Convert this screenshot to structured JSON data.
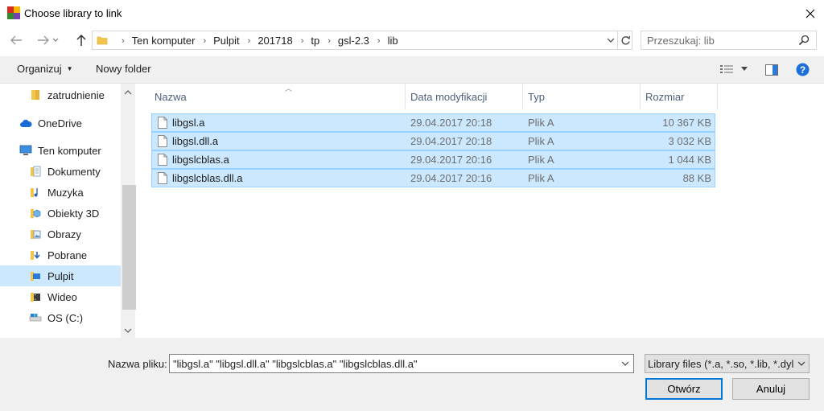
{
  "window": {
    "title": "Choose library to link"
  },
  "address": {
    "crumbs": [
      "Ten komputer",
      "Pulpit",
      "201718",
      "tp",
      "gsl-2.3",
      "lib"
    ]
  },
  "search": {
    "placeholder": "Przeszukaj: lib"
  },
  "toolbar": {
    "organize_label": "Organizuj",
    "new_folder_label": "Nowy folder"
  },
  "sidebar": {
    "items": [
      {
        "label": "zatrudnienie",
        "icon": "folder-icon"
      },
      {
        "label": "OneDrive",
        "icon": "cloud-icon"
      },
      {
        "label": "Ten komputer",
        "icon": "computer-icon"
      },
      {
        "label": "Dokumenty",
        "icon": "documents-icon"
      },
      {
        "label": "Muzyka",
        "icon": "music-icon"
      },
      {
        "label": "Obiekty 3D",
        "icon": "3d-objects-icon"
      },
      {
        "label": "Obrazy",
        "icon": "pictures-icon"
      },
      {
        "label": "Pobrane",
        "icon": "downloads-icon"
      },
      {
        "label": "Pulpit",
        "icon": "desktop-icon"
      },
      {
        "label": "Wideo",
        "icon": "video-icon"
      },
      {
        "label": "OS (C:)",
        "icon": "drive-icon"
      }
    ],
    "selected": "Pulpit"
  },
  "columns": {
    "name": "Nazwa",
    "date": "Data modyfikacji",
    "type": "Typ",
    "size": "Rozmiar"
  },
  "files": [
    {
      "name": "libgsl.a",
      "date": "29.04.2017 20:18",
      "type": "Plik A",
      "size": "10 367 KB"
    },
    {
      "name": "libgsl.dll.a",
      "date": "29.04.2017 20:18",
      "type": "Plik A",
      "size": "3 032 KB"
    },
    {
      "name": "libgslcblas.a",
      "date": "29.04.2017 20:16",
      "type": "Plik A",
      "size": "1 044 KB"
    },
    {
      "name": "libgslcblas.dll.a",
      "date": "29.04.2017 20:16",
      "type": "Plik A",
      "size": "88 KB"
    }
  ],
  "footer": {
    "filename_label": "Nazwa pliku:",
    "filename_value": "\"libgsl.a\" \"libgsl.dll.a\" \"libgslcblas.a\" \"libgslcblas.dll.a\"",
    "filter_value": "Library files (*.a, *.so, *.lib, *.dyli",
    "open_label": "Otwórz",
    "cancel_label": "Anuluj"
  },
  "colors": {
    "selection": "#cce8ff",
    "selection_border": "#99d1ff",
    "accent": "#0078d7"
  }
}
